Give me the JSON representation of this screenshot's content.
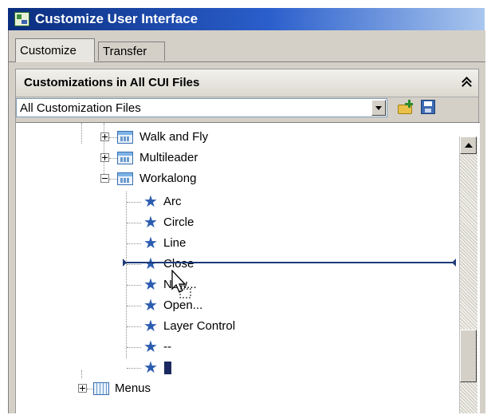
{
  "window": {
    "title": "Customize User Interface"
  },
  "tabs": [
    {
      "label": "Customize",
      "active": true
    },
    {
      "label": "Transfer",
      "active": false
    }
  ],
  "panel": {
    "title": "Customizations in All CUI Files",
    "file_filter": {
      "selected": "All Customization Files"
    }
  },
  "tree": {
    "toolbars": [
      {
        "label": "Walk and Fly",
        "expanded": false,
        "icon": "toolbar-icon"
      },
      {
        "label": "Multileader",
        "expanded": false,
        "icon": "toolbar-icon"
      },
      {
        "label": "Workalong",
        "expanded": true,
        "icon": "toolbar-icon"
      }
    ],
    "workalong_items": [
      {
        "label": "Arc",
        "icon": "star-icon"
      },
      {
        "label": "Circle",
        "icon": "star-icon"
      },
      {
        "label": "Line",
        "icon": "star-icon"
      },
      {
        "label": "Close",
        "icon": "star-icon"
      },
      {
        "label": "New...",
        "icon": "star-icon"
      },
      {
        "label": "Open...",
        "icon": "star-icon"
      },
      {
        "label": "Layer Control",
        "icon": "star-icon"
      },
      {
        "label": "--",
        "icon": "star-icon"
      },
      {
        "label": "",
        "icon": "star-icon",
        "selected": true
      }
    ],
    "menus": {
      "label": "Menus",
      "expanded": false,
      "icon": "menu-icon"
    }
  },
  "colors": {
    "title_bar_start": "#0a2d7e",
    "accent_blue": "#2b5cb0",
    "insert_marker": "#1e3a78"
  }
}
